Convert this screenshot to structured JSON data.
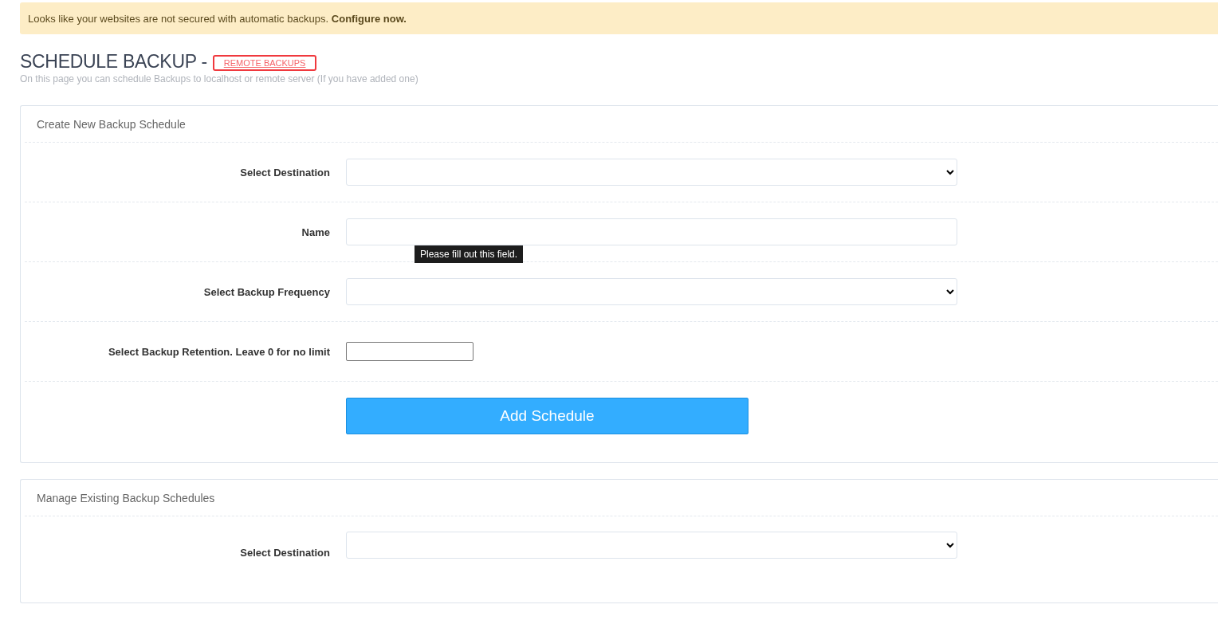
{
  "alert": {
    "text": "Looks like your websites are not secured with automatic backups. **Configure now.**"
  },
  "header": {
    "title": "SCHEDULE BACKUP -",
    "link": "REMOTE BACKUPS",
    "subtitle": "On this page you can schedule Backups to localhost or remote server (If you have added one)"
  },
  "create_panel": {
    "title": "Create New Backup Schedule",
    "fields": [
      {
        "kind": "select",
        "label": "Select Destination"
      },
      {
        "kind": "text",
        "label": "Name",
        "tooltip": "Please fill out this field."
      },
      {
        "kind": "select",
        "label": "Select Backup Frequency"
      },
      {
        "kind": "number",
        "label": "Select Backup Retention. Leave 0 for no limit"
      }
    ],
    "button": "Add Schedule"
  },
  "manage_panel": {
    "title": "Manage Existing Backup Schedules",
    "fields": [
      {
        "kind": "select",
        "label": "Select Destination"
      }
    ]
  }
}
